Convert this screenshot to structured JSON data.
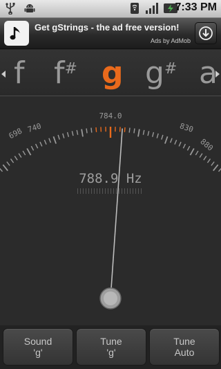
{
  "status_bar": {
    "time": "7:33 PM"
  },
  "ad": {
    "title": "Get gStrings - the ad free version!",
    "attribution": "Ads by AdMob"
  },
  "notes": {
    "items": [
      {
        "name": "f",
        "sharp": ""
      },
      {
        "name": "f",
        "sharp": "#"
      },
      {
        "name": "g",
        "sharp": ""
      },
      {
        "name": "g",
        "sharp": "#"
      },
      {
        "name": "a",
        "sharp": ""
      }
    ],
    "selected": "g"
  },
  "meter": {
    "target_label": "784.0",
    "left_labels": [
      "698",
      "740"
    ],
    "right_labels": [
      "830",
      "880"
    ],
    "frequency": "788.9 Hz",
    "needle_deflection_deg": 4,
    "accent_color": "#e96a1c"
  },
  "buttons": [
    {
      "line1": "Sound",
      "line2": "'g'"
    },
    {
      "line1": "Tune",
      "line2": "'g'"
    },
    {
      "line1": "Tune",
      "line2": "Auto"
    }
  ]
}
